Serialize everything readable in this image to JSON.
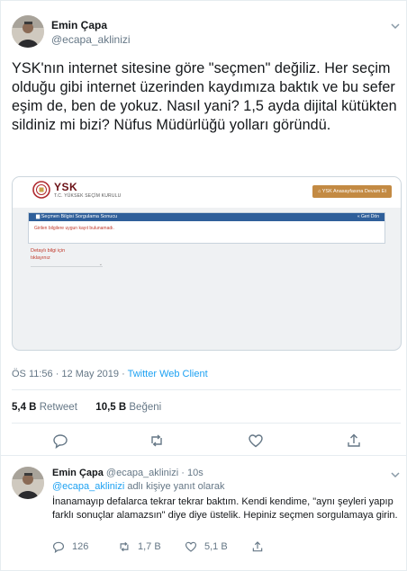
{
  "main_tweet": {
    "author_name": "Emin Çapa",
    "author_handle": "@ecapa_aklinizi",
    "text": "YSK'nın internet sitesine göre \"seçmen\" değiliz. Her seçim olduğu gibi internet üzerinden kaydımıza baktık ve bu sefer eşim de, ben de yokuz. Nasıl yani? 1,5 ayda dijital kütükten sildiniz mi bizi? Nüfus Müdürlüğü yolları göründü.",
    "timestamp": "ÖS 11:56 · 12 May 2019 · ",
    "client": "Twitter Web Client",
    "retweets_count": "5,4 B",
    "retweets_label": "Retweet",
    "likes_count": "10,5 B",
    "likes_label": "Beğeni"
  },
  "media": {
    "logo_title": "YSK",
    "logo_subtitle": "T.C. YÜKSEK SEÇİM KURULU",
    "home_button": "YSK Anasayfasına Devam Et",
    "panel_title": "Seçmen Bilgisi Sorgulama Sonucu",
    "back_link": "Geri Dön",
    "error_message": "Girilen bilgilere uygun kayıt bulunamadı.",
    "detail_link_line1": "Detaylı bilgi için",
    "detail_link_line2": "tıklayınız"
  },
  "actions": {
    "icons": [
      "reply-icon",
      "retweet-icon",
      "like-icon",
      "share-icon"
    ]
  },
  "reply_tweet": {
    "author_name": "Emin Çapa",
    "author_handle": "@ecapa_aklinizi",
    "time": "· 10s",
    "reply_to_mention": "@ecapa_aklinizi",
    "reply_to_suffix": " adlı kişiye yanıt olarak",
    "text": "İnanamayıp defalarca tekrar tekrar baktım. Kendi kendime, \"aynı şeyleri yapıp farklı sonuçlar alamazsın\" diye diye üstelik. Hepiniz seçmen sorgulamaya girin.",
    "reply_count": "126",
    "retweet_count": "1,7 B",
    "like_count": "5,1 B"
  },
  "colors": {
    "accent": "#1da1f2",
    "text": "#14171a",
    "muted": "#657786",
    "ysk_brand": "#6b1116",
    "ysk_button": "#c38a43",
    "ysk_header": "#2f5f9a"
  }
}
